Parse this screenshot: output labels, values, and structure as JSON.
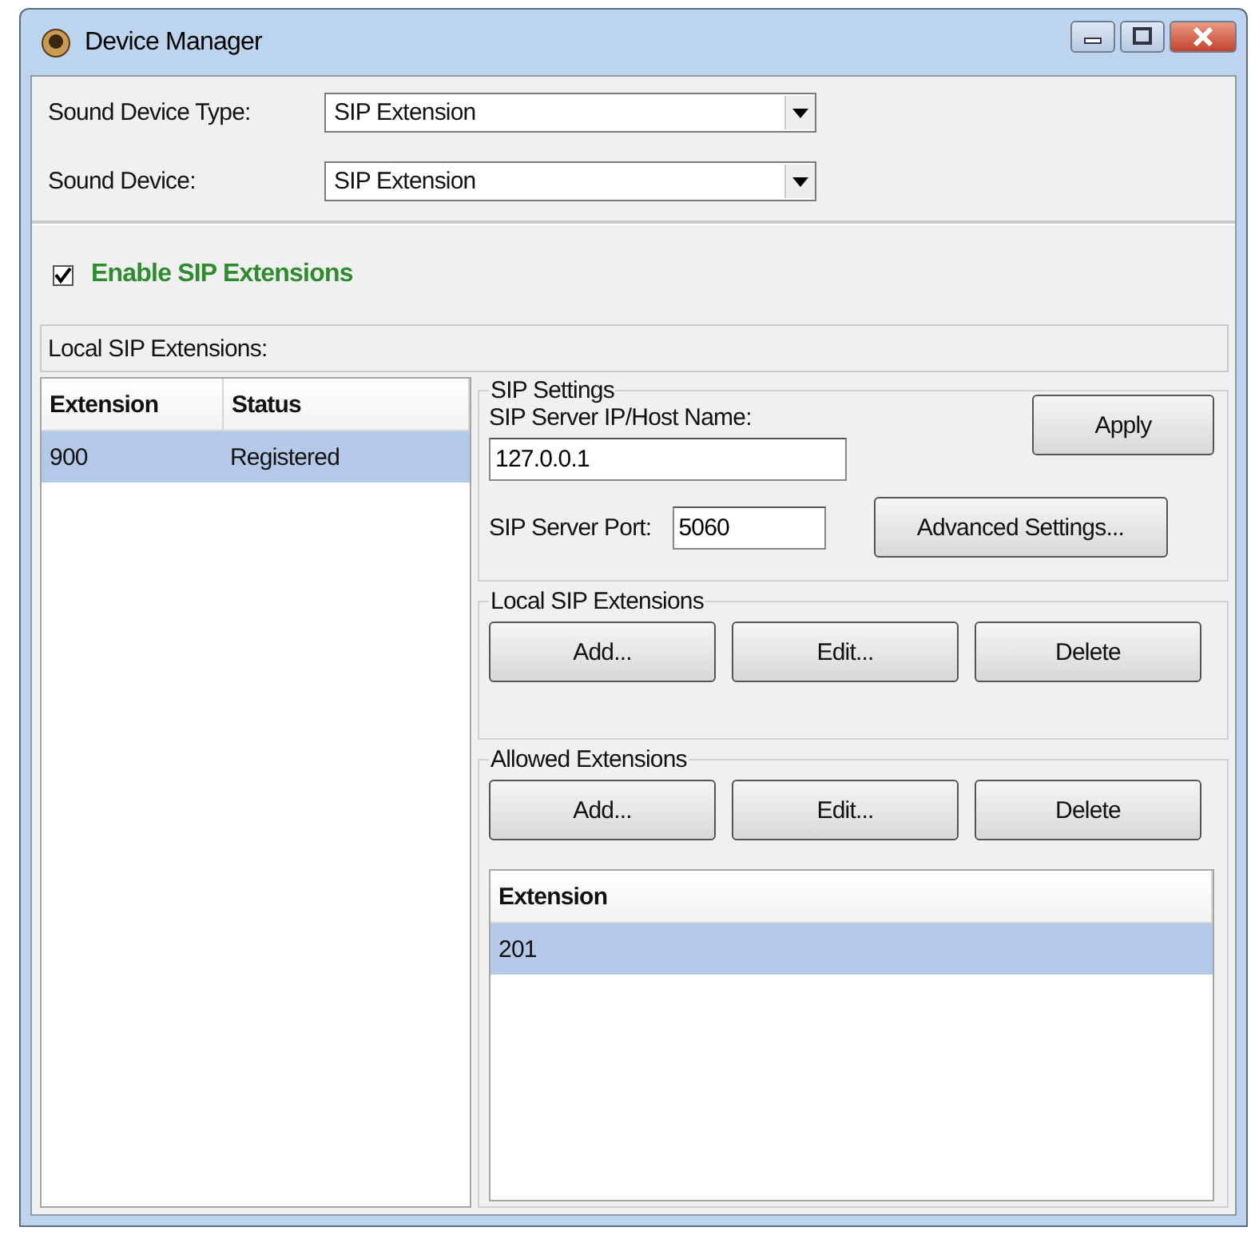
{
  "window": {
    "title": "Device Manager"
  },
  "sound_device_type": {
    "label": "Sound Device Type:",
    "value": "SIP Extension"
  },
  "sound_device": {
    "label": "Sound Device:",
    "value": "SIP Extension"
  },
  "enable_sip": {
    "label": "Enable SIP Extensions",
    "checked": true
  },
  "local_extensions_label": "Local SIP Extensions:",
  "extensions_table": {
    "columns": [
      "Extension",
      "Status"
    ],
    "rows": [
      {
        "cells": [
          "900",
          "Registered"
        ],
        "selected": true
      }
    ]
  },
  "sip_settings": {
    "title": "SIP Settings",
    "host_label": "SIP Server IP/Host Name:",
    "host_value": "127.0.0.1",
    "port_label": "SIP Server Port:",
    "port_value": "5060",
    "apply_button": "Apply",
    "advanced_button": "Advanced Settings..."
  },
  "local_group": {
    "title": "Local SIP Extensions",
    "buttons": [
      "Add...",
      "Edit...",
      "Delete"
    ]
  },
  "allowed_group": {
    "title": "Allowed Extensions",
    "buttons": [
      "Add...",
      "Edit...",
      "Delete"
    ],
    "table": {
      "columns": [
        "Extension"
      ],
      "rows": [
        {
          "cells": [
            "201"
          ],
          "selected": true
        }
      ]
    }
  }
}
